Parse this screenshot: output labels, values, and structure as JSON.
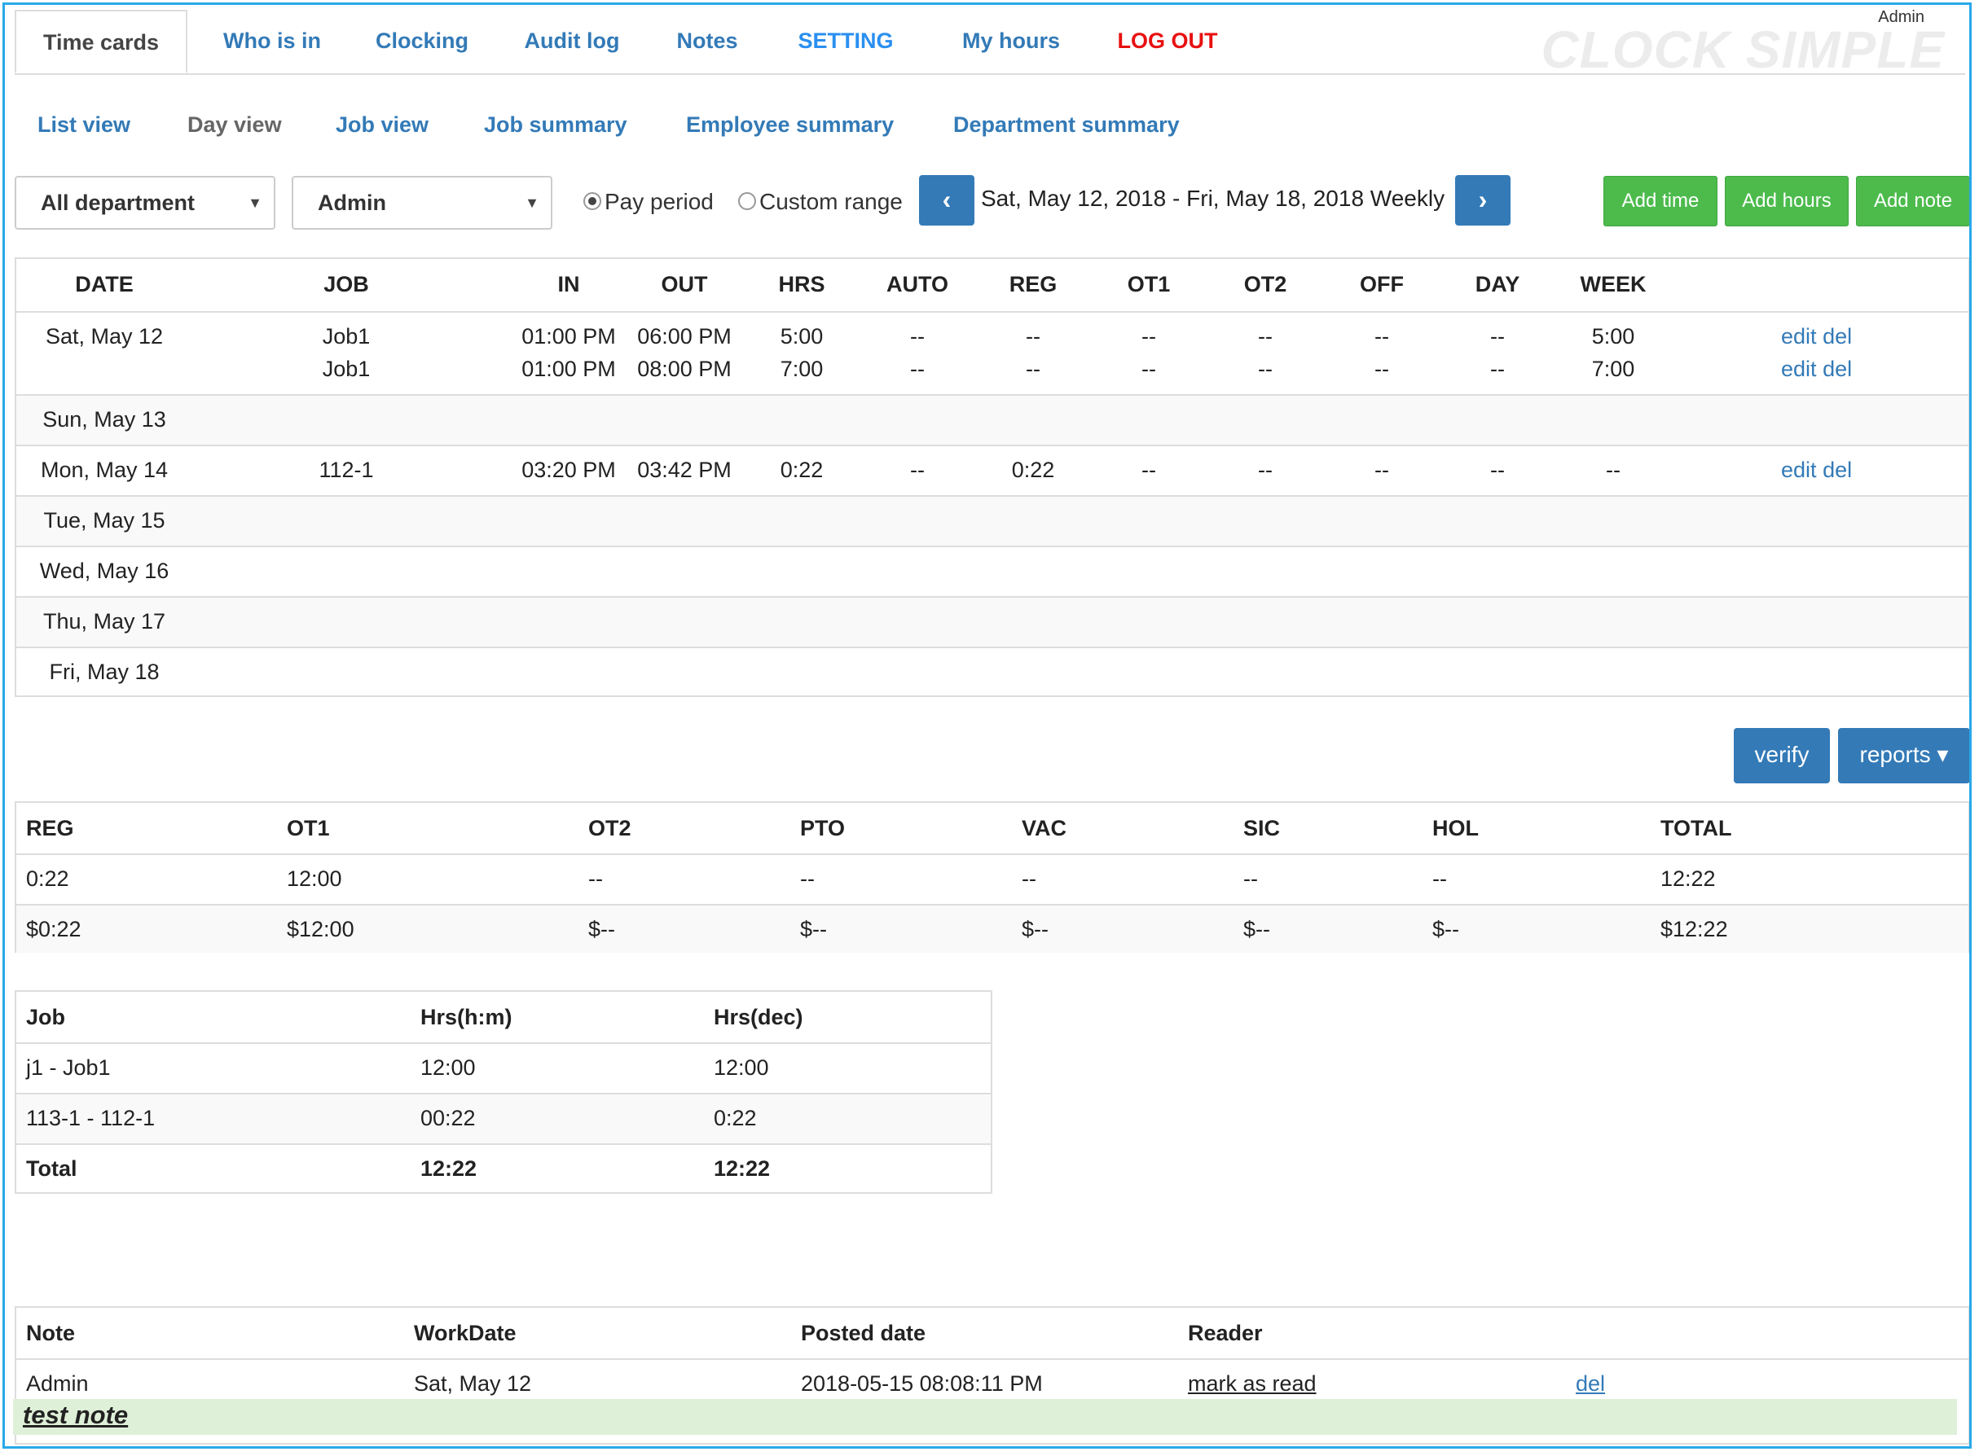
{
  "header": {
    "brand": "CLOCK SIMPLE",
    "user": "Admin",
    "tabs": [
      "Time cards",
      "Who is in",
      "Clocking",
      "Audit log",
      "Notes",
      "SETTING",
      "My hours",
      "LOG OUT"
    ]
  },
  "subnav": [
    "List view",
    "Day view",
    "Job view",
    "Job summary",
    "Employee summary",
    "Department summary"
  ],
  "filters": {
    "department": "All department",
    "employee": "Admin",
    "radio_pay_period": "Pay period",
    "radio_custom_range": "Custom range",
    "range_text": "Sat, May 12, 2018 - Fri, May 18, 2018 Weekly"
  },
  "buttons": {
    "add_time": "Add time",
    "add_hours": "Add hours",
    "add_note": "Add note",
    "verify": "verify",
    "reports": "reports ▾"
  },
  "timecard": {
    "headers": [
      "DATE",
      "JOB",
      "IN",
      "OUT",
      "HRS",
      "AUTO",
      "REG",
      "OT1",
      "OT2",
      "OFF",
      "DAY",
      "WEEK"
    ],
    "days": [
      {
        "date": "Sat, May 12",
        "entries": [
          {
            "job": "Job1",
            "in": "01:00 PM",
            "out": "06:00 PM",
            "hrs": "5:00",
            "auto": "--",
            "reg": "--",
            "ot1": "--",
            "ot2": "--",
            "off": "--",
            "day": "--",
            "week": "5:00",
            "edit": "edit",
            "del": "del"
          },
          {
            "job": "Job1",
            "in": "01:00 PM",
            "out": "08:00 PM",
            "hrs": "7:00",
            "auto": "--",
            "reg": "--",
            "ot1": "--",
            "ot2": "--",
            "off": "--",
            "day": "--",
            "week": "7:00",
            "edit": "edit",
            "del": "del"
          }
        ]
      },
      {
        "date": "Sun, May 13",
        "entries": []
      },
      {
        "date": "Mon, May 14",
        "entries": [
          {
            "job": "112-1",
            "in": "03:20 PM",
            "out": "03:42 PM",
            "hrs": "0:22",
            "auto": "--",
            "reg": "0:22",
            "ot1": "--",
            "ot2": "--",
            "off": "--",
            "day": "--",
            "week": "--",
            "edit": "edit",
            "del": "del"
          }
        ]
      },
      {
        "date": "Tue, May 15",
        "entries": []
      },
      {
        "date": "Wed, May 16",
        "entries": []
      },
      {
        "date": "Thu, May 17",
        "entries": []
      },
      {
        "date": "Fri, May 18",
        "entries": []
      }
    ]
  },
  "totals": {
    "headers": [
      "REG",
      "OT1",
      "OT2",
      "PTO",
      "VAC",
      "SIC",
      "HOL",
      "TOTAL"
    ],
    "hours": [
      "0:22",
      "12:00",
      "--",
      "--",
      "--",
      "--",
      "--",
      "12:22"
    ],
    "pay": [
      "$0:22",
      "$12:00",
      "$--",
      "$--",
      "$--",
      "$--",
      "$--",
      "$12:22"
    ]
  },
  "jobs": {
    "headers": [
      "Job",
      "Hrs(h:m)",
      "Hrs(dec)"
    ],
    "rows": [
      [
        "j1 - Job1",
        "12:00",
        "12:00"
      ],
      [
        "113-1 - 112-1",
        "00:22",
        "0:22"
      ]
    ],
    "total": [
      "Total",
      "12:22",
      "12:22"
    ]
  },
  "notes": {
    "headers": [
      "Note",
      "WorkDate",
      "Posted date",
      "Reader"
    ],
    "items": [
      {
        "author": "Admin",
        "workdate": "Sat, May 12",
        "posted": "2018-05-15 08:08:11 PM",
        "reader": "mark as read ",
        "del": "del",
        "text": "test note"
      }
    ]
  }
}
